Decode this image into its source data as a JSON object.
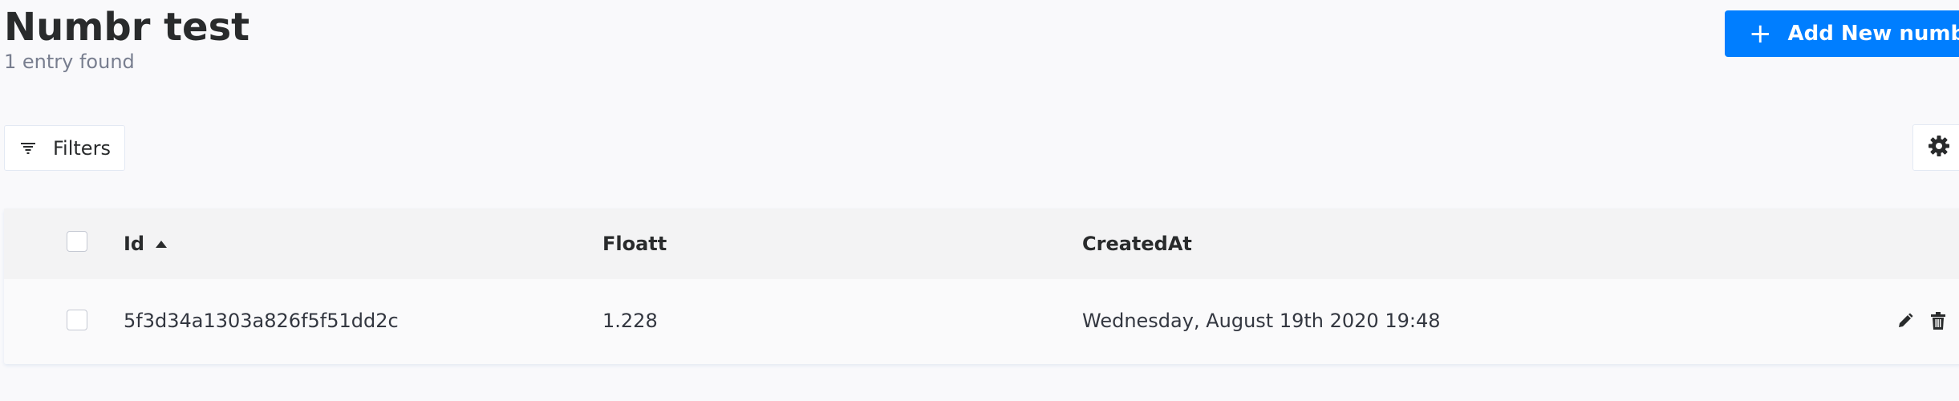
{
  "header": {
    "title": "Numbr test",
    "subtitle": "1 entry found",
    "add_button_label": "Add New numbr test"
  },
  "toolbar": {
    "filters_label": "Filters",
    "filter_icon": "filter-lines-icon",
    "settings_icon": "gear-icon"
  },
  "table": {
    "columns": [
      {
        "label": "Id",
        "sort": "ascending"
      },
      {
        "label": "Floatt"
      },
      {
        "label": "CreatedAt"
      }
    ],
    "rows": [
      {
        "id": "5f3d34a1303a826f5f51dd2c",
        "floatt": "1.228",
        "createdAt": "Wednesday, August 19th 2020 19:48",
        "selected": false
      }
    ],
    "row_actions": [
      "pencil-icon",
      "trash-icon"
    ]
  },
  "colors": {
    "accent": "#007eff",
    "background": "#f9f9fb",
    "header_row": "#f3f3f4",
    "text": "#292b2c",
    "muted": "#787e8f"
  }
}
